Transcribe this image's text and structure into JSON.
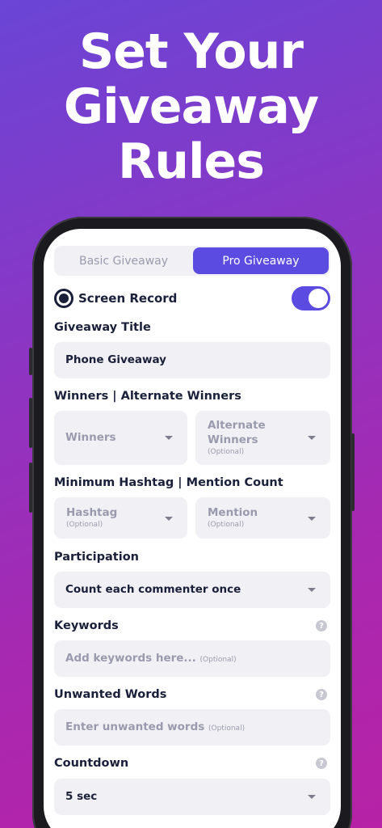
{
  "headline": {
    "line1": "Set Your",
    "line2": "Giveaway",
    "line3": "Rules"
  },
  "segment": {
    "basic_label": "Basic Giveaway",
    "pro_label": "Pro Giveaway",
    "selected": "Pro Giveaway"
  },
  "screen_record": {
    "label": "Screen Record",
    "enabled": true
  },
  "giveaway_title": {
    "label": "Giveaway Title",
    "value": "Phone Giveaway"
  },
  "winners": {
    "label": "Winners | Alternate Winners",
    "winners_placeholder": "Winners",
    "alternate_line1": "Alternate",
    "alternate_line2": "Winners",
    "alternate_optional": "(Optional)"
  },
  "min_count": {
    "label": "Minimum Hashtag | Mention Count",
    "hashtag_placeholder": "Hashtag",
    "hashtag_optional": "(Optional)",
    "mention_placeholder": "Mention",
    "mention_optional": "(Optional)"
  },
  "participation": {
    "label": "Participation",
    "value": "Count each commenter once"
  },
  "keywords": {
    "label": "Keywords",
    "placeholder": "Add keywords here...",
    "optional": "(Optional)"
  },
  "unwanted_words": {
    "label": "Unwanted Words",
    "placeholder": "Enter unwanted words",
    "optional": "(Optional)"
  },
  "countdown": {
    "label": "Countdown",
    "value": "5 sec"
  },
  "help_glyph": "?",
  "colors": {
    "accent": "#5b4be0",
    "text_dark": "#1a1f3a",
    "field_bg": "#f1f1f5",
    "placeholder": "#9a9aae"
  }
}
